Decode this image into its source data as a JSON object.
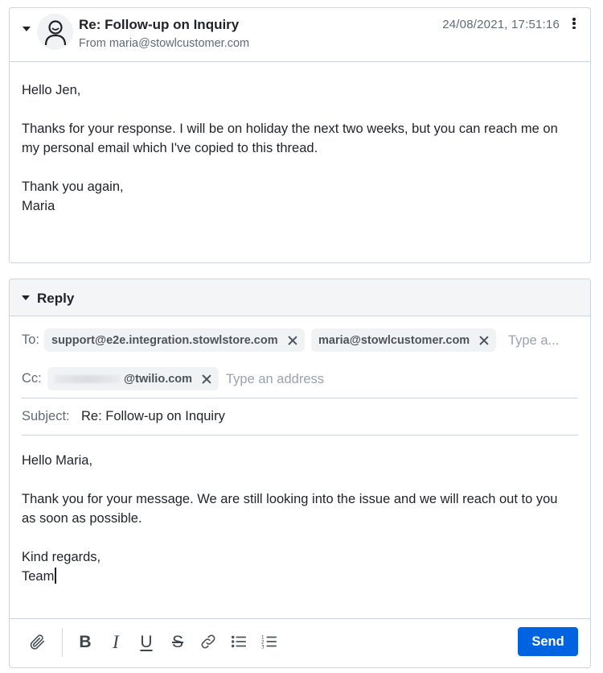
{
  "message": {
    "subject": "Re: Follow-up on Inquiry",
    "from": "From maria@stowlcustomer.com",
    "date": "24/08/2021, 17:51:16",
    "body": {
      "greeting": "Hello Jen,",
      "paragraph": "Thanks for your response. I will be on holiday the next two weeks, but you can reach me on my personal email which I've copied to this thread.",
      "closing": "Thank you again,",
      "signature": "Maria"
    }
  },
  "reply": {
    "header_label": "Reply",
    "to_label": "To:",
    "to_recipients": [
      "support@e2e.integration.stowlstore.com",
      "maria@stowlcustomer.com"
    ],
    "to_placeholder": "Type a...",
    "cc_label": "Cc:",
    "cc_recipients": [
      "@twilio.com"
    ],
    "cc_placeholder": "Type an address",
    "subject_label": "Subject:",
    "subject_value": "Re: Follow-up on Inquiry",
    "body": {
      "greeting": "Hello Maria,",
      "paragraph": "Thank you for your message. We are still looking into the issue and we will reach out to you as soon as possible.",
      "closing": "Kind regards,",
      "signature": "Team"
    },
    "toolbar": {
      "bold": "B",
      "italic": "I",
      "underline": "U",
      "strikethrough": "S",
      "send_label": "Send"
    }
  },
  "colors": {
    "accent": "#0263e0",
    "border": "#cfd3da",
    "muted_text": "#606b76",
    "chip_bg": "#f1f2f4"
  },
  "icons": [
    "chevron-down-icon",
    "user-avatar-icon",
    "more-vertical-icon",
    "close-icon",
    "attachment-icon",
    "bold-icon",
    "italic-icon",
    "underline-icon",
    "strikethrough-icon",
    "link-icon",
    "bulleted-list-icon",
    "numbered-list-icon"
  ]
}
